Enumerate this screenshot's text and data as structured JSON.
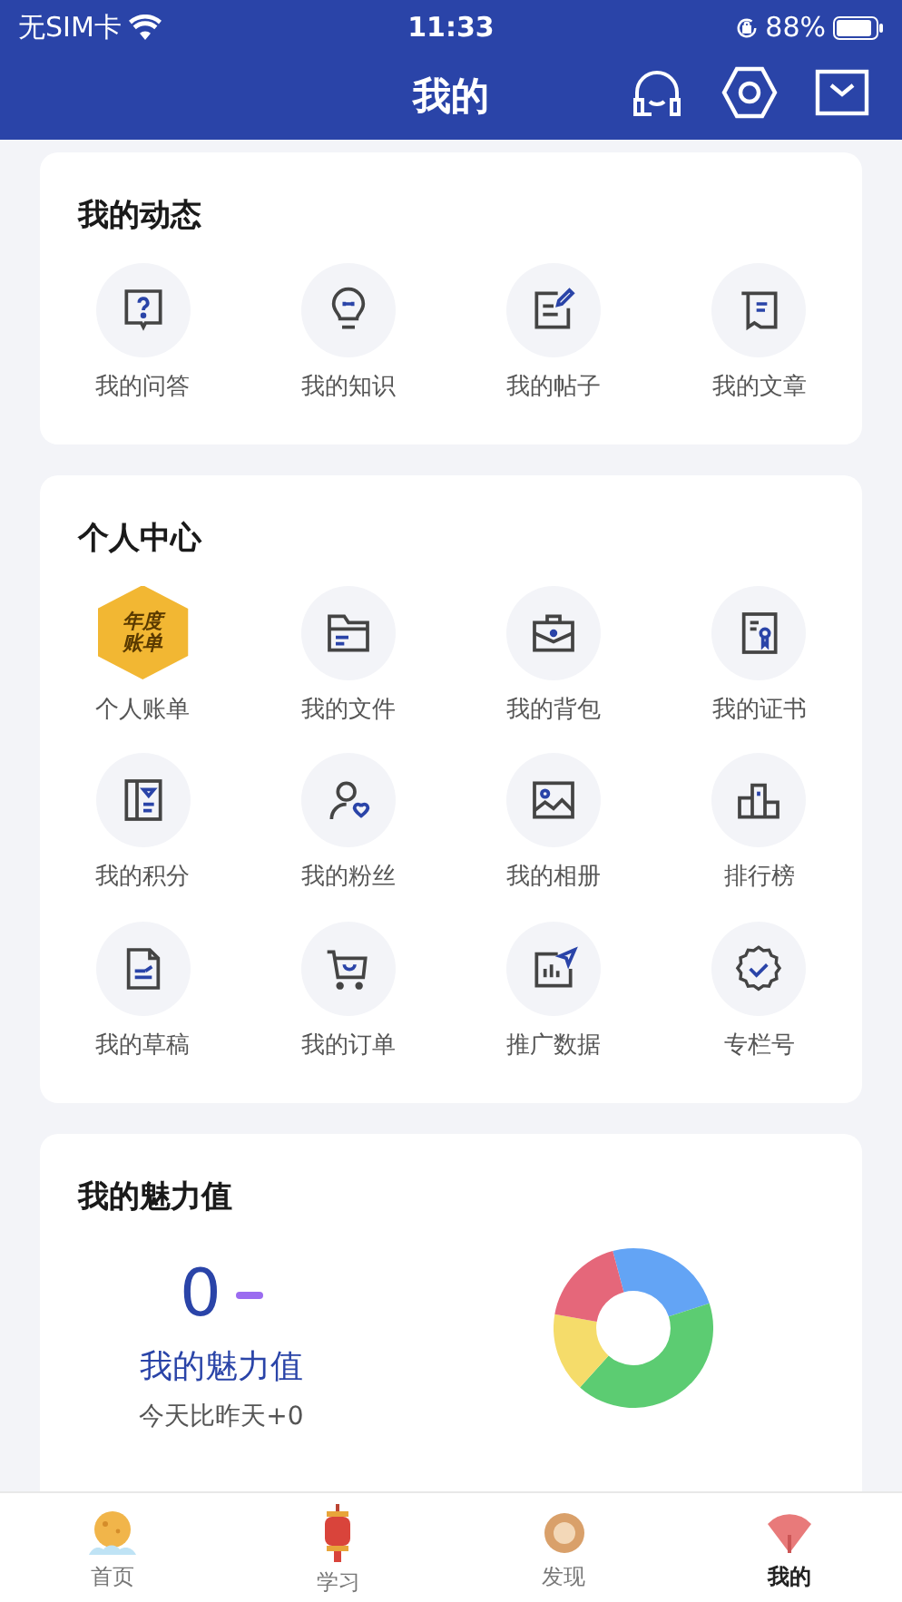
{
  "status_bar": {
    "carrier": "无SIM卡",
    "time": "11:33",
    "battery": "88%"
  },
  "header": {
    "title": "我的"
  },
  "sections": [
    {
      "title": "我的动态",
      "items": [
        {
          "kind": "icon",
          "label": "我的问答"
        },
        {
          "kind": "icon",
          "label": "我的知识"
        },
        {
          "kind": "icon",
          "label": "我的帖子"
        },
        {
          "kind": "icon",
          "label": "我的文章"
        }
      ]
    },
    {
      "title": "个人中心",
      "items": [
        {
          "kind": "badge",
          "badge_lines": [
            "年度",
            "账单"
          ],
          "label": "个人账单"
        },
        {
          "kind": "icon",
          "label": "我的文件"
        },
        {
          "kind": "icon",
          "label": "我的背包"
        },
        {
          "kind": "icon",
          "label": "我的证书"
        },
        {
          "kind": "icon",
          "label": "我的积分"
        },
        {
          "kind": "icon",
          "label": "我的粉丝"
        },
        {
          "kind": "icon",
          "label": "我的相册"
        },
        {
          "kind": "icon",
          "label": "排行榜"
        },
        {
          "kind": "icon",
          "label": "我的草稿"
        },
        {
          "kind": "icon",
          "label": "我的订单"
        },
        {
          "kind": "icon",
          "label": "推广数据"
        },
        {
          "kind": "icon",
          "label": "专栏号"
        }
      ]
    }
  ],
  "charm": {
    "title": "我的魅力值",
    "value": "0",
    "label": "我的魅力值",
    "change": "今天比昨天+0"
  },
  "tab_bar": [
    {
      "label": "首页",
      "selected": false
    },
    {
      "label": "学习",
      "selected": false
    },
    {
      "label": "发现",
      "selected": false
    },
    {
      "label": "我的",
      "selected": true
    }
  ]
}
